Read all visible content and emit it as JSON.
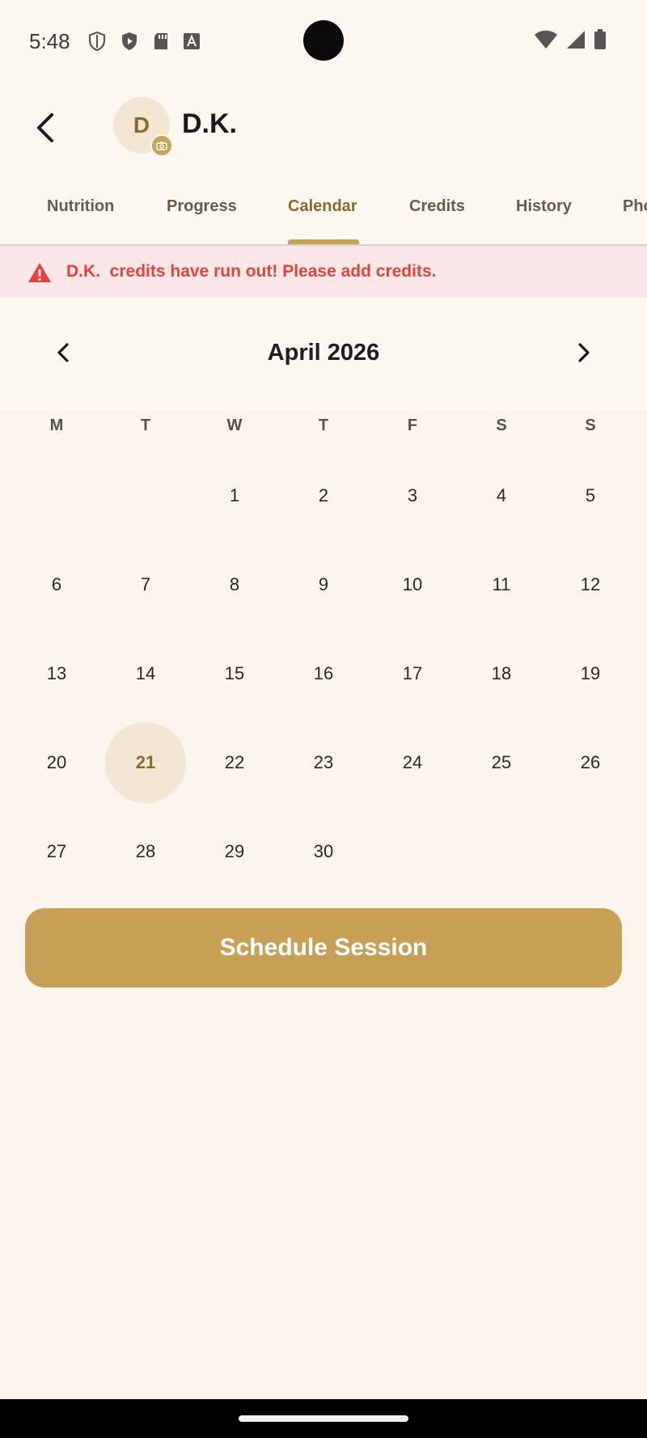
{
  "status_bar": {
    "time": "5:48",
    "icons": [
      "shield-icon",
      "play-shield-icon",
      "sd-card-icon",
      "font-a-icon"
    ],
    "right_icons": [
      "wifi-icon",
      "signal-icon",
      "battery-icon"
    ]
  },
  "header": {
    "avatar_initial": "D",
    "client_name": "D.K."
  },
  "tabs": [
    {
      "label": "Nutrition",
      "active": false
    },
    {
      "label": "Progress",
      "active": false
    },
    {
      "label": "Calendar",
      "active": true
    },
    {
      "label": "Credits",
      "active": false
    },
    {
      "label": "History",
      "active": false
    },
    {
      "label": "Pho",
      "active": false
    }
  ],
  "alert": {
    "text": "D.K.  credits have run out! Please add credits.",
    "color": "#e0433b",
    "background": "#fde6e8"
  },
  "calendar": {
    "month_title": "April 2026",
    "weekdays": [
      "M",
      "T",
      "W",
      "T",
      "F",
      "S",
      "S"
    ],
    "weeks": [
      [
        "",
        "",
        "1",
        "2",
        "3",
        "4",
        "5"
      ],
      [
        "6",
        "7",
        "8",
        "9",
        "10",
        "11",
        "12"
      ],
      [
        "13",
        "14",
        "15",
        "16",
        "17",
        "18",
        "19"
      ],
      [
        "20",
        "21",
        "22",
        "23",
        "24",
        "25",
        "26"
      ],
      [
        "27",
        "28",
        "29",
        "30",
        "",
        "",
        ""
      ]
    ],
    "selected_day": "21"
  },
  "actions": {
    "schedule_label": "Schedule Session"
  },
  "colors": {
    "accent": "#c7a055",
    "accent_dark": "#8a6a2a",
    "background": "#fbf4ec"
  }
}
